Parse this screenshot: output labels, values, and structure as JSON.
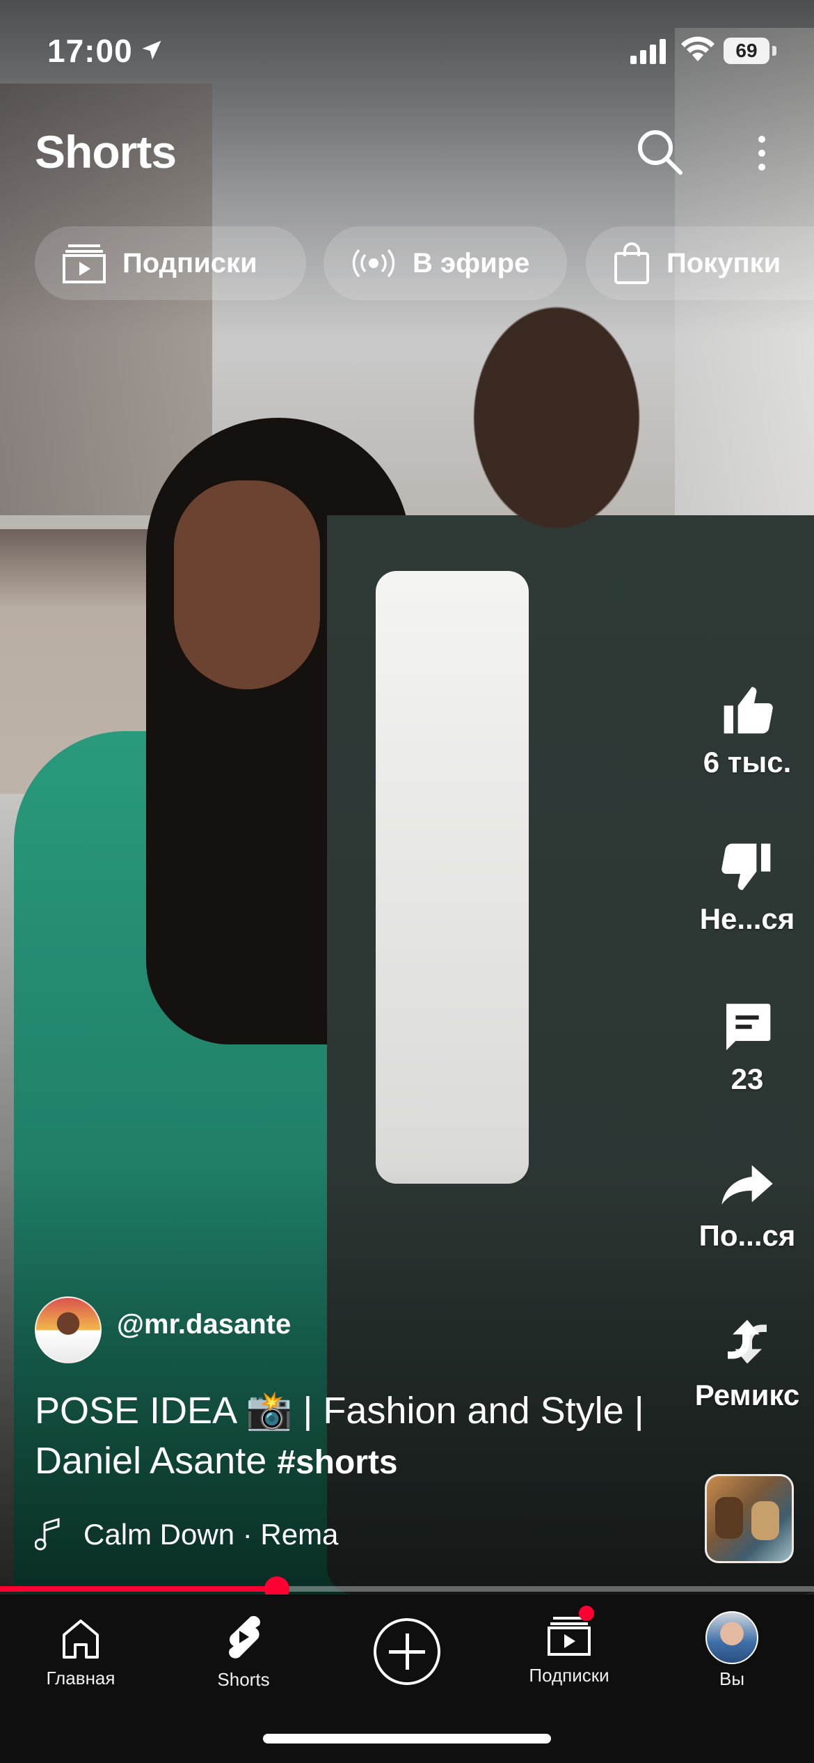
{
  "status_bar": {
    "time": "17:00",
    "battery": "69"
  },
  "header": {
    "title": "Shorts"
  },
  "chips": [
    {
      "label": "Подписки",
      "icon": "subscriptions-icon"
    },
    {
      "label": "В эфире",
      "icon": "live-icon"
    },
    {
      "label": "Покупки",
      "icon": "shopping-bag-icon"
    }
  ],
  "actions": {
    "like": "6 тыс.",
    "dislike": "Не...ся",
    "comments": "23",
    "share": "По...ся",
    "remix": "Ремикс"
  },
  "video": {
    "channel_handle": "@mr.dasante",
    "caption": "POSE IDEA 📸 | Fashion and Style | Daniel Asante ",
    "hashtag": "#shorts",
    "music": "Calm Down · Rema",
    "progress": 0.34
  },
  "nav": [
    {
      "label": "Главная",
      "icon": "home-icon"
    },
    {
      "label": "Shorts",
      "icon": "shorts-icon"
    },
    {
      "label": "",
      "icon": "create-icon"
    },
    {
      "label": "Подписки",
      "icon": "subscriptions-icon"
    },
    {
      "label": "Вы",
      "icon": "avatar"
    }
  ],
  "colors": {
    "accent": "#ff0033",
    "nav_bg": "#0f0f0f",
    "chip_bg": "rgba(255,255,255,0.16)"
  }
}
